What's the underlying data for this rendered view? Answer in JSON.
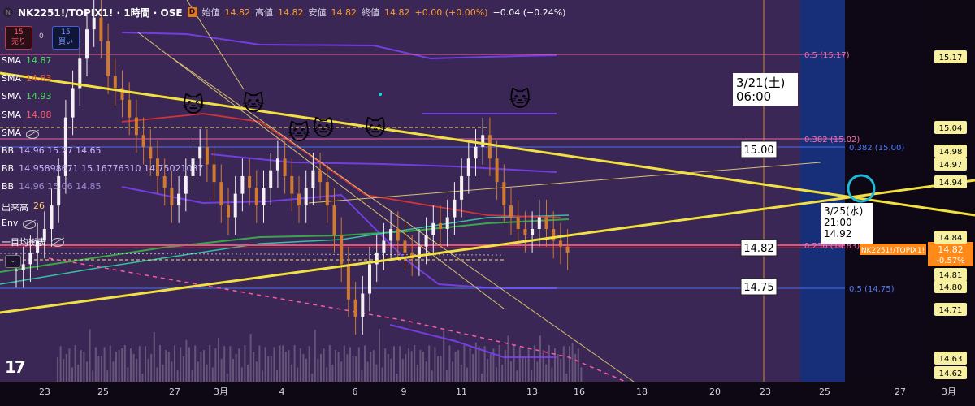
{
  "header": {
    "symbol": "NK2251!/TOPIX1! · 1時間 · OSE",
    "open_label": "始値",
    "open": "14.82",
    "high_label": "高値",
    "high": "14.82",
    "low_label": "安値",
    "low": "14.82",
    "close_label": "終値",
    "close": "14.82",
    "change": "+0.00 (+0.00%)",
    "change2": "−0.04 (−0.24%)",
    "logo_d": "D"
  },
  "trade": {
    "sell_qty": "15",
    "sell_label": "売り",
    "spread": "0",
    "buy_qty": "15",
    "buy_label": "買い"
  },
  "indicators": [
    {
      "name": "SMA",
      "value": "14.87",
      "color": "#4cd964"
    },
    {
      "name": "SMA",
      "value": "14.83",
      "color": "#e0522a"
    },
    {
      "name": "SMA",
      "value": "14.93",
      "color": "#4cd964"
    },
    {
      "name": "SMA",
      "value": "14.88",
      "color": "#ff5b6e"
    },
    {
      "name": "SMA",
      "value": "",
      "color": "#aaaaaa"
    },
    {
      "name": "BB",
      "value": "14.96 15.27 14.65",
      "color": "#c7b6ff"
    },
    {
      "name": "BB",
      "value": "14.95898671 15.16776310 14.75021037",
      "color": "#c7b6ff"
    },
    {
      "name": "BB",
      "value": "14.96 15.06 14.85",
      "color": "#9a8ad0"
    },
    {
      "name": "出来高",
      "value": "26",
      "color": "#ffcc66"
    },
    {
      "name": "Env",
      "value": "",
      "color": "#aaaaaa"
    },
    {
      "name": "一目均衡表",
      "value": "",
      "color": "#aaaaaa"
    }
  ],
  "chart_data": {
    "type": "line",
    "title": "NK2251!/TOPIX1! · 1時間 · OSE",
    "x_ticks": [
      "23",
      "25",
      "27",
      "3月",
      "4",
      "6",
      "9",
      "11",
      "13",
      "16",
      "18",
      "20",
      "23",
      "25",
      "27",
      "3月"
    ],
    "y_ticks": [
      15.17,
      15.04,
      14.98,
      14.97,
      14.94,
      14.84,
      14.81,
      14.8,
      14.71,
      14.63,
      14.62
    ],
    "ylim": [
      14.6,
      15.25
    ],
    "fib_levels": [
      {
        "label": "0.5 (15.17)",
        "value": 15.17,
        "color": "#ff6aa8"
      },
      {
        "label": "0.382 (15.02)",
        "value": 15.02,
        "color": "#ff6aa8"
      },
      {
        "label": "0.236 (14.83)",
        "value": 14.83,
        "color": "#ff6aa8"
      },
      {
        "label": "0.382 (15.00)",
        "value": 15.0,
        "color": "#4d7cff"
      },
      {
        "label": "0.5 (14.75)",
        "value": 14.75,
        "color": "#4d7cff"
      }
    ],
    "price_boxes": [
      "15.00",
      "14.82",
      "14.75"
    ],
    "annotations": [
      {
        "text": "3/21(土)\n06:00"
      },
      {
        "text": "3/25(水)\n21:00\n14.92"
      }
    ],
    "current_price": {
      "symbol": "NK2251!/TOPIX1!",
      "price": "14.82",
      "change": "-0.57%"
    },
    "closes": [
      14.79,
      14.8,
      14.82,
      14.84,
      14.86,
      14.9,
      14.95,
      15.05,
      15.1,
      15.15,
      15.2,
      15.22,
      15.18,
      15.12,
      15.1,
      15.08,
      15.05,
      15.02,
      15.0,
      14.98,
      14.95,
      14.93,
      14.9,
      14.92,
      14.95,
      14.98,
      15.0,
      14.97,
      14.94,
      14.9,
      14.88,
      14.92,
      14.95,
      14.93,
      14.9,
      14.93,
      14.96,
      14.98,
      14.95,
      14.92,
      14.9,
      14.93,
      14.96,
      14.94,
      14.9,
      14.85,
      14.8,
      14.74,
      14.71,
      14.75,
      14.8,
      14.82,
      14.84,
      14.86,
      14.84,
      14.82,
      14.81,
      14.83,
      14.85,
      14.87,
      14.86,
      14.88,
      14.91,
      14.95,
      14.98,
      15.0,
      15.02,
      14.98,
      14.94,
      14.9,
      14.88,
      14.86,
      14.85,
      14.86,
      14.88,
      14.86,
      14.84,
      14.83,
      14.82
    ]
  },
  "colors": {
    "bg": "#14091f",
    "panel": "#3a2755",
    "future": "#172e78",
    "trend": "#f2e040",
    "accent": "#ff8a1a"
  },
  "watermark": "17"
}
